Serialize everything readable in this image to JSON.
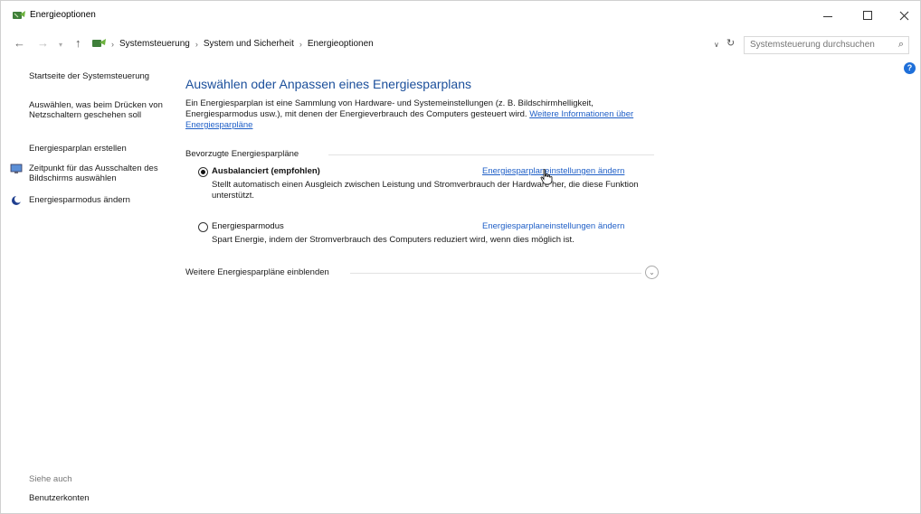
{
  "window": {
    "title": "Energieoptionen",
    "minimize_icon": "minimize-icon",
    "maximize_icon": "maximize-icon",
    "close_icon": "close-icon"
  },
  "navigation": {
    "back_icon": "←",
    "forward_icon": "→",
    "recent_icon": "▾",
    "up_icon": "↑",
    "breadcrumb": [
      "Systemsteuerung",
      "System und Sicherheit",
      "Energieoptionen"
    ],
    "breadcrumb_separator": "›",
    "dropdown_icon": "∨",
    "refresh_icon": "↻",
    "search_placeholder": "Systemsteuerung durchsuchen",
    "search_icon": "⌕"
  },
  "sidebar": {
    "items": [
      {
        "label": "Startseite der Systemsteuerung"
      },
      {
        "label": "Auswählen, was beim Drücken von Netzschaltern geschehen soll"
      },
      {
        "label": "Energiesparplan erstellen"
      },
      {
        "label": "Zeitpunkt für das Ausschalten des Bildschirms auswählen",
        "icon": "monitor-icon"
      },
      {
        "label": "Energiesparmodus ändern",
        "icon": "moon-icon"
      }
    ],
    "see_also_label": "Siehe auch",
    "see_also_items": [
      {
        "label": "Benutzerkonten"
      }
    ]
  },
  "help_icon": "?",
  "main": {
    "title": "Auswählen oder Anpassen eines Energiesparplans",
    "intro_text": "Ein Energiesparplan ist eine Sammlung von Hardware- und Systemeinstellungen (z. B. Bildschirmhelligkeit, Energiesparmodus usw.), mit denen der Energieverbrauch des Computers gesteuert wird.",
    "intro_link": "Weitere Informationen über Energiesparpläne",
    "section_label": "Bevorzugte Energiesparpläne",
    "plans": [
      {
        "name": "Ausbalanciert (empfohlen)",
        "selected": true,
        "description": "Stellt automatisch einen Ausgleich zwischen Leistung und Stromverbrauch der Hardware her, die diese Funktion unterstützt.",
        "link": "Energiesparplaneinstellungen ändern"
      },
      {
        "name": "Energiesparmodus",
        "selected": false,
        "description": "Spart Energie, indem der Stromverbrauch des Computers reduziert wird, wenn dies möglich ist.",
        "link": "Energiesparplaneinstellungen ändern"
      }
    ],
    "more_plans_label": "Weitere Energiesparpläne einblenden",
    "more_plans_icon": "⌄"
  }
}
